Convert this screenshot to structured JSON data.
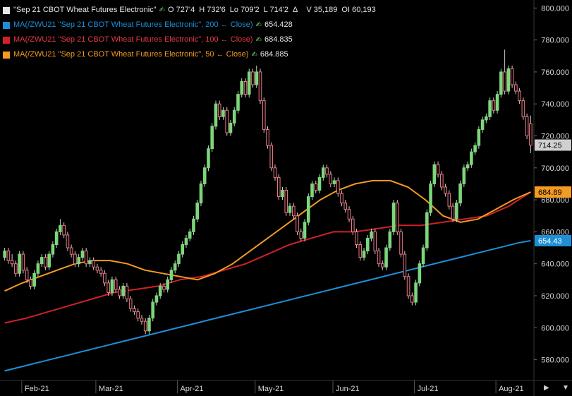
{
  "header": {
    "symbol_label": "\"Sep 21 CBOT Wheat Futures Electronic\"",
    "open": "O 727'4",
    "high": "H 732'6",
    "low": "Lo 709'2",
    "last": "L 714'2",
    "delta": "Δ",
    "volume": "V 35,189",
    "oi": "OI 60,193"
  },
  "icons": {
    "hand_icon": "✍",
    "bar_icon": "⫽",
    "scroll_right": "▶",
    "scroll_down": "▼"
  },
  "indicators": [
    {
      "label": "MA(/ZWU21 \"Sep 21 CBOT Wheat Futures Electronic\", 200 ← Close)",
      "value": "654.428",
      "color": "#1e8fd6"
    },
    {
      "label": "MA(/ZWU21 \"Sep 21 CBOT Wheat Futures Electronic\", 100 ← Close)",
      "value": "684.835",
      "color": "#d0202a"
    },
    {
      "label": "MA(/ZWU21 \"Sep 21 CBOT Wheat Futures Electronic\", 50 ← Close)",
      "value": "684.885",
      "color": "#f39a22"
    }
  ],
  "colors": {
    "up": "#7cd67a",
    "down": "#f07a85",
    "wick": "#cccccc",
    "grid": "#2a2a2a",
    "axis_text": "#d8d8d8",
    "last_tag": "#d0d0d0"
  },
  "chart_data": {
    "type": "candlestick",
    "ylim": [
      567,
      805
    ],
    "y_ticks": [
      "580.000",
      "600.000",
      "620.000",
      "640.000",
      "660.000",
      "680.000",
      "700.000",
      "720.000",
      "740.000",
      "760.000",
      "780.000",
      "800.000"
    ],
    "x_labels": [
      "Feb-21",
      "Mar-21",
      "Apr-21",
      "May-21",
      "Jun-21",
      "Jul-21",
      "Aug-21"
    ],
    "x_label_index": [
      5,
      25,
      47,
      68,
      89,
      111,
      133
    ],
    "closes": [
      648,
      642,
      640,
      634,
      646,
      636,
      630,
      626,
      634,
      640,
      644,
      638,
      646,
      652,
      660,
      664,
      658,
      650,
      646,
      640,
      644,
      648,
      640,
      642,
      638,
      636,
      634,
      628,
      622,
      630,
      624,
      620,
      626,
      618,
      612,
      610,
      606,
      604,
      598,
      606,
      616,
      620,
      626,
      624,
      630,
      636,
      640,
      646,
      652,
      656,
      660,
      668,
      678,
      690,
      700,
      712,
      726,
      740,
      732,
      736,
      722,
      728,
      736,
      746,
      754,
      746,
      760,
      752,
      760,
      742,
      724,
      714,
      700,
      694,
      682,
      686,
      672,
      676,
      670,
      660,
      656,
      666,
      682,
      690,
      686,
      694,
      700,
      696,
      690,
      692,
      684,
      678,
      674,
      668,
      660,
      652,
      644,
      648,
      656,
      660,
      648,
      640,
      638,
      650,
      660,
      678,
      660,
      646,
      632,
      620,
      616,
      628,
      640,
      650,
      672,
      690,
      702,
      696,
      688,
      684,
      676,
      668,
      678,
      690,
      700,
      702,
      710,
      714,
      724,
      730,
      732,
      742,
      736,
      746,
      760,
      748,
      762,
      752,
      748,
      742,
      732,
      720,
      714.25
    ],
    "opens": [
      644,
      648,
      642,
      640,
      634,
      646,
      636,
      630,
      626,
      634,
      640,
      644,
      638,
      646,
      652,
      660,
      664,
      658,
      650,
      646,
      640,
      644,
      648,
      640,
      642,
      638,
      636,
      634,
      628,
      622,
      630,
      624,
      620,
      626,
      618,
      612,
      610,
      606,
      604,
      598,
      606,
      616,
      620,
      626,
      624,
      630,
      636,
      640,
      646,
      652,
      656,
      660,
      668,
      678,
      690,
      700,
      712,
      726,
      740,
      732,
      736,
      722,
      728,
      736,
      746,
      754,
      746,
      760,
      752,
      760,
      742,
      724,
      714,
      700,
      694,
      682,
      686,
      672,
      676,
      670,
      660,
      656,
      666,
      682,
      690,
      686,
      694,
      700,
      696,
      690,
      692,
      684,
      678,
      674,
      668,
      660,
      652,
      644,
      648,
      656,
      660,
      648,
      640,
      638,
      650,
      660,
      678,
      660,
      646,
      632,
      620,
      616,
      628,
      640,
      650,
      672,
      690,
      702,
      696,
      688,
      684,
      676,
      668,
      678,
      690,
      700,
      702,
      710,
      714,
      724,
      730,
      732,
      742,
      736,
      746,
      760,
      748,
      762,
      752,
      748,
      742,
      732,
      727.5
    ],
    "highs": [
      650,
      650,
      646,
      642,
      648,
      648,
      638,
      632,
      636,
      642,
      646,
      646,
      648,
      654,
      662,
      668,
      666,
      660,
      652,
      648,
      646,
      650,
      650,
      644,
      644,
      640,
      638,
      636,
      630,
      632,
      632,
      626,
      628,
      628,
      620,
      614,
      612,
      608,
      606,
      608,
      618,
      622,
      628,
      628,
      632,
      638,
      642,
      648,
      654,
      658,
      662,
      670,
      680,
      692,
      702,
      714,
      728,
      742,
      742,
      738,
      738,
      730,
      738,
      748,
      756,
      756,
      762,
      762,
      764,
      762,
      744,
      726,
      716,
      702,
      696,
      688,
      688,
      678,
      678,
      672,
      662,
      668,
      684,
      692,
      692,
      696,
      702,
      702,
      698,
      694,
      694,
      686,
      680,
      676,
      670,
      662,
      654,
      650,
      658,
      662,
      662,
      650,
      642,
      652,
      662,
      680,
      680,
      662,
      648,
      634,
      622,
      630,
      642,
      652,
      674,
      692,
      704,
      704,
      698,
      690,
      686,
      678,
      680,
      692,
      702,
      704,
      712,
      716,
      726,
      732,
      734,
      744,
      744,
      748,
      762,
      774,
      764,
      764,
      754,
      750,
      744,
      734,
      732.75
    ],
    "lows": [
      642,
      640,
      638,
      632,
      632,
      634,
      628,
      624,
      624,
      632,
      638,
      636,
      636,
      644,
      650,
      658,
      656,
      648,
      644,
      638,
      638,
      642,
      638,
      638,
      636,
      634,
      632,
      626,
      620,
      620,
      622,
      618,
      618,
      616,
      610,
      608,
      604,
      602,
      596,
      596,
      604,
      614,
      618,
      622,
      622,
      628,
      634,
      638,
      644,
      650,
      654,
      658,
      666,
      676,
      688,
      698,
      710,
      724,
      730,
      730,
      720,
      720,
      726,
      734,
      744,
      744,
      744,
      750,
      750,
      740,
      722,
      712,
      698,
      692,
      680,
      680,
      670,
      670,
      668,
      658,
      654,
      654,
      664,
      680,
      684,
      684,
      692,
      694,
      688,
      688,
      682,
      676,
      672,
      666,
      658,
      650,
      642,
      642,
      646,
      654,
      646,
      638,
      636,
      636,
      648,
      658,
      658,
      644,
      630,
      618,
      614,
      614,
      626,
      638,
      648,
      670,
      688,
      694,
      686,
      682,
      674,
      666,
      666,
      676,
      688,
      698,
      700,
      708,
      712,
      722,
      728,
      730,
      734,
      734,
      744,
      746,
      746,
      750,
      746,
      740,
      730,
      718,
      709.25
    ],
    "ma200": [
      573,
      575,
      577,
      579,
      581,
      583,
      585,
      587,
      589,
      591,
      593,
      595,
      597,
      599,
      601,
      603,
      605,
      607,
      609,
      611,
      613,
      615,
      617,
      619,
      621,
      623,
      625,
      627,
      629,
      631,
      633,
      635,
      637,
      639,
      641,
      643,
      645,
      647,
      649,
      651,
      653,
      654.428
    ],
    "ma100": [
      603,
      606,
      610,
      614,
      618,
      622,
      624,
      626,
      630,
      632,
      636,
      640,
      646,
      652,
      656,
      660,
      660,
      662,
      664,
      664,
      666,
      668,
      670,
      676,
      684.835
    ],
    "ma50": [
      623,
      628,
      632,
      636,
      640,
      642,
      642,
      640,
      636,
      634,
      632,
      630,
      634,
      640,
      648,
      656,
      664,
      672,
      680,
      686,
      690,
      692,
      692,
      688,
      680,
      670,
      666,
      668,
      674,
      680,
      684.885
    ]
  }
}
